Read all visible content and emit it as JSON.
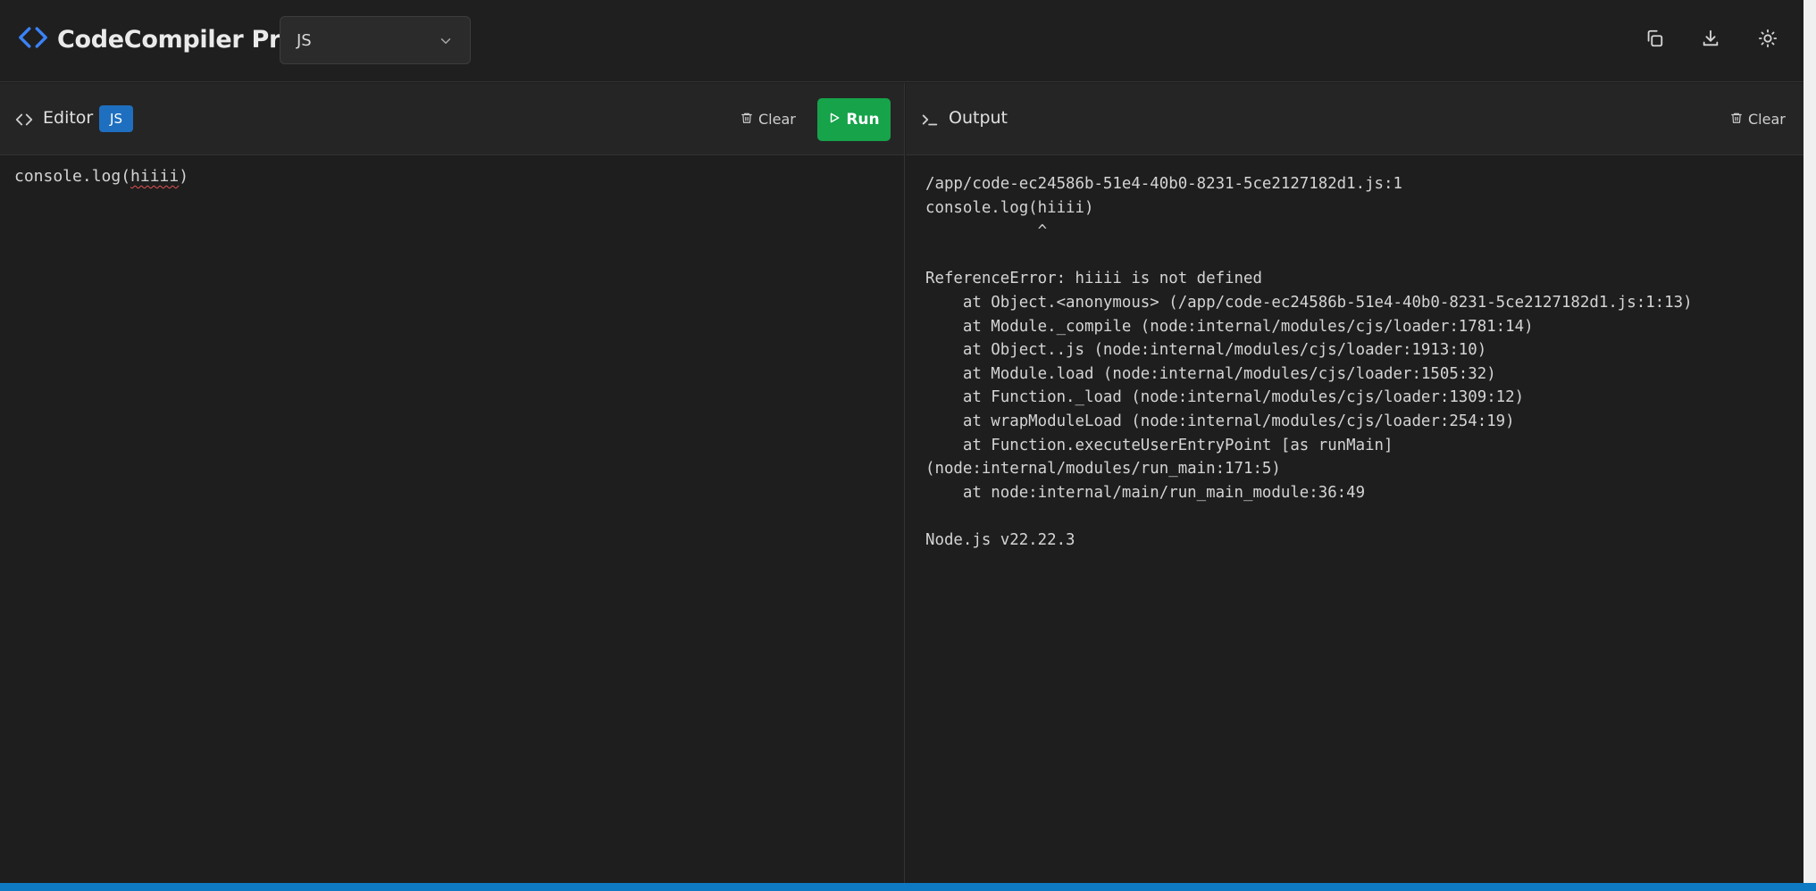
{
  "app": {
    "title": "CodeCompiler Pro",
    "logo_icon": "code-brackets-icon",
    "brand_color": "#3b82f6"
  },
  "language_select": {
    "value": "JS",
    "icon": "chevron-down-icon"
  },
  "toolbar": {
    "copy_icon": "copy-icon",
    "download_icon": "download-icon",
    "theme_icon": "sun-icon"
  },
  "editor": {
    "title": "Editor",
    "language_badge": "JS",
    "clear_label": "Clear",
    "run_label": "Run",
    "code_prefix": "console.log(",
    "code_error_token": "hiiii",
    "code_suffix": ")",
    "run_color": "#16a34a",
    "badge_color": "#1e6fbf"
  },
  "output": {
    "title": "Output",
    "clear_label": "Clear",
    "text": "/app/code-ec24586b-51e4-40b0-8231-5ce2127182d1.js:1\nconsole.log(hiiii)\n            ^\n\nReferenceError: hiiii is not defined\n    at Object.<anonymous> (/app/code-ec24586b-51e4-40b0-8231-5ce2127182d1.js:1:13)\n    at Module._compile (node:internal/modules/cjs/loader:1781:14)\n    at Object..js (node:internal/modules/cjs/loader:1913:10)\n    at Module.load (node:internal/modules/cjs/loader:1505:32)\n    at Function._load (node:internal/modules/cjs/loader:1309:12)\n    at wrapModuleLoad (node:internal/modules/cjs/loader:254:19)\n    at Function.executeUserEntryPoint [as runMain]\n(node:internal/modules/run_main:171:5)\n    at node:internal/main/run_main_module:36:49\n\nNode.js v22.22.3"
  },
  "statusbar_color": "#0e7ac4"
}
